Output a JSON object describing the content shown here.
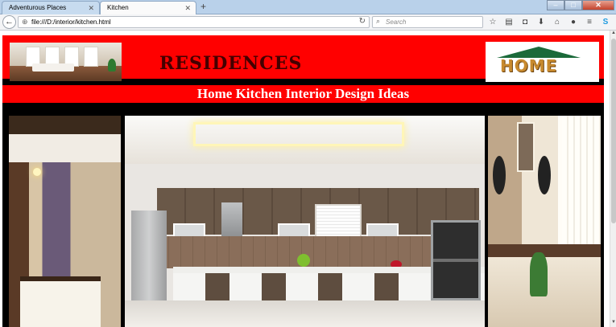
{
  "browser": {
    "tabs": [
      {
        "label": "Adventurous Places",
        "active": false
      },
      {
        "label": "Kitchen",
        "active": true
      }
    ],
    "new_tab_icon": "plus-icon",
    "url": "file:///D:/interior/kitchen.html",
    "search_placeholder": "Search",
    "toolbar_icons": [
      "star-icon",
      "reading-list-icon",
      "pocket-icon",
      "download-icon",
      "home-icon",
      "chat-icon",
      "menu-icon",
      "skype-icon",
      "menu-icon"
    ]
  },
  "page": {
    "logo_text": "RESIDENCES",
    "home_logo_text": "HOME",
    "subtitle": "Home Kitchen Interior Design Ideas",
    "colors": {
      "banner": "#ff0000",
      "background": "#000000",
      "logo_text": "#400000"
    }
  }
}
